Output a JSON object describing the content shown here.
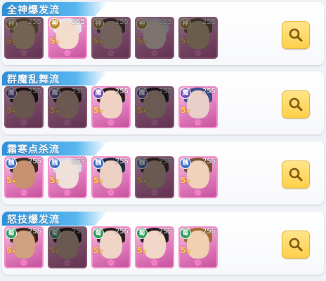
{
  "groups": [
    {
      "title": "全神爆发流",
      "heroes": [
        {
          "badge": "神",
          "level": "255",
          "star": "5",
          "dim": true,
          "hair": "#8a6a3c",
          "skin": "#d9b38c",
          "badgeColor": "#b8842a"
        },
        {
          "badge": "神",
          "level": "255",
          "star": "5",
          "dim": false,
          "hair": "#e8e4ea",
          "skin": "#f4dccc",
          "badgeColor": "#b8842a"
        },
        {
          "badge": "神",
          "level": "255",
          "star": "5",
          "dim": true,
          "hair": "#5a3c3c",
          "skin": "#d8b0a0",
          "badgeColor": "#b8842a"
        },
        {
          "badge": "神",
          "level": "255",
          "star": "5",
          "dim": true,
          "hair": "#cfc9d6",
          "skin": "#e4cfc6",
          "badgeColor": "#b8842a"
        },
        {
          "badge": "神",
          "level": "255",
          "star": "5",
          "dim": true,
          "hair": "#6e5a3c",
          "skin": "#c8a882",
          "badgeColor": "#b8842a"
        }
      ]
    },
    {
      "title": "群魔乱舞流",
      "heroes": [
        {
          "badge": "魔",
          "level": "255",
          "star": "5",
          "dim": true,
          "hair": "#2a1a1a",
          "skin": "#c49a88",
          "badgeColor": "#6a4ab0"
        },
        {
          "badge": "魔",
          "level": "255",
          "star": "5",
          "dim": true,
          "hair": "#3a2222",
          "skin": "#c89e8e",
          "badgeColor": "#6a4ab0"
        },
        {
          "badge": "魔",
          "level": "255",
          "star": "5",
          "dim": false,
          "hair": "#2c1c20",
          "skin": "#f0d2c4",
          "badgeColor": "#6a4ab0"
        },
        {
          "badge": "魔",
          "level": "255",
          "star": "5",
          "dim": true,
          "hair": "#2c2030",
          "skin": "#c8a294",
          "badgeColor": "#6a4ab0"
        },
        {
          "badge": "魔",
          "level": "255",
          "star": "5",
          "dim": false,
          "hair": "#3a4a8a",
          "skin": "#e8cfc8",
          "badgeColor": "#6a4ab0"
        }
      ]
    },
    {
      "title": "霜寒点杀流",
      "heroes": [
        {
          "badge": "魏",
          "level": "255",
          "star": "5",
          "dim": false,
          "hair": "#3a2a22",
          "skin": "#c89270",
          "badgeColor": "#3a6ac0"
        },
        {
          "badge": "魏",
          "level": "255",
          "star": "5",
          "dim": false,
          "hair": "#dcdce4",
          "skin": "#f0e0da",
          "badgeColor": "#3a6ac0"
        },
        {
          "badge": "魏",
          "level": "255",
          "star": "5",
          "dim": false,
          "hair": "#1e2a44",
          "skin": "#ecd0c2",
          "badgeColor": "#3a6ac0"
        },
        {
          "badge": "魏",
          "level": "255",
          "star": "5",
          "dim": true,
          "hair": "#4a3024",
          "skin": "#c8a08c",
          "badgeColor": "#3a6ac0"
        },
        {
          "badge": "魏",
          "level": "255",
          "star": "5",
          "dim": false,
          "hair": "#7a5030",
          "skin": "#f0d2bc",
          "badgeColor": "#3a6ac0"
        }
      ]
    },
    {
      "title": "怒技爆发流",
      "heroes": [
        {
          "badge": "蜀",
          "level": "255",
          "star": "5",
          "dim": false,
          "hair": "#3a2418",
          "skin": "#d0a080",
          "badgeColor": "#2a9a5a"
        },
        {
          "badge": "蜀",
          "level": "255",
          "star": "5",
          "dim": true,
          "hair": "#2a1a16",
          "skin": "#c8a08c",
          "badgeColor": "#2a9a5a"
        },
        {
          "badge": "蜀",
          "level": "255",
          "star": "5",
          "dim": false,
          "hair": "#281c1c",
          "skin": "#f0d4c6",
          "badgeColor": "#2a9a5a"
        },
        {
          "badge": "蜀",
          "level": "255",
          "star": "5",
          "dim": false,
          "hair": "#241a1c",
          "skin": "#f2d6c8",
          "badgeColor": "#2a9a5a"
        },
        {
          "badge": "蜀",
          "level": "255",
          "star": "5",
          "dim": false,
          "hair": "#a06a30",
          "skin": "#f0d0b0",
          "badgeColor": "#2a9a5a"
        }
      ]
    }
  ]
}
